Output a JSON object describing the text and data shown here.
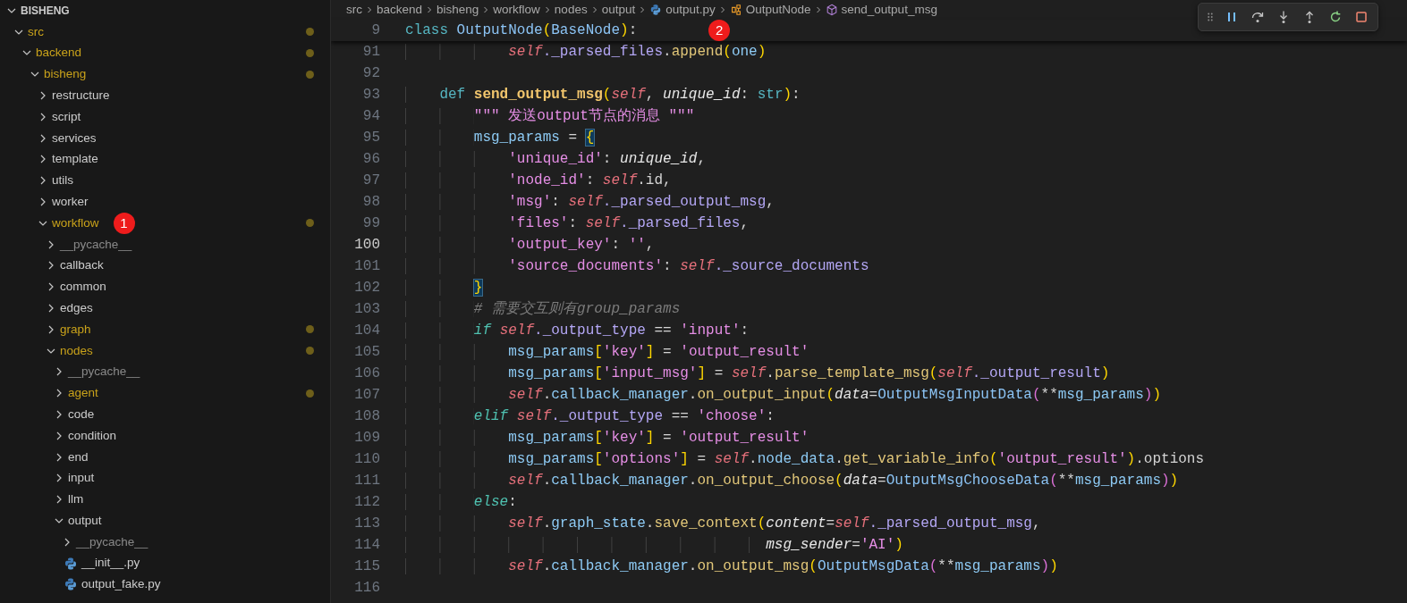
{
  "explorer": {
    "title": "BISHENG",
    "expanded": true,
    "items": [
      {
        "label": "src",
        "kind": "folder",
        "expanded": true,
        "modified": true,
        "ignored": false,
        "children": [
          {
            "label": "backend",
            "kind": "folder",
            "expanded": true,
            "modified": true,
            "ignored": false,
            "children": [
              {
                "label": "bisheng",
                "kind": "folder",
                "expanded": true,
                "modified": true,
                "ignored": false,
                "children": [
                  {
                    "label": "restructure",
                    "kind": "folder",
                    "expanded": false,
                    "modified": false,
                    "ignored": false
                  },
                  {
                    "label": "script",
                    "kind": "folder",
                    "expanded": false,
                    "modified": false,
                    "ignored": false
                  },
                  {
                    "label": "services",
                    "kind": "folder",
                    "expanded": false,
                    "modified": false,
                    "ignored": false
                  },
                  {
                    "label": "template",
                    "kind": "folder",
                    "expanded": false,
                    "modified": false,
                    "ignored": false
                  },
                  {
                    "label": "utils",
                    "kind": "folder",
                    "expanded": false,
                    "modified": false,
                    "ignored": false
                  },
                  {
                    "label": "worker",
                    "kind": "folder",
                    "expanded": false,
                    "modified": false,
                    "ignored": false
                  },
                  {
                    "label": "workflow",
                    "kind": "folder",
                    "expanded": true,
                    "modified": true,
                    "ignored": false,
                    "badge": "1",
                    "children": [
                      {
                        "label": "__pycache__",
                        "kind": "folder",
                        "expanded": false,
                        "modified": false,
                        "ignored": true
                      },
                      {
                        "label": "callback",
                        "kind": "folder",
                        "expanded": false,
                        "modified": false,
                        "ignored": false
                      },
                      {
                        "label": "common",
                        "kind": "folder",
                        "expanded": false,
                        "modified": false,
                        "ignored": false
                      },
                      {
                        "label": "edges",
                        "kind": "folder",
                        "expanded": false,
                        "modified": false,
                        "ignored": false
                      },
                      {
                        "label": "graph",
                        "kind": "folder",
                        "expanded": false,
                        "modified": true,
                        "ignored": false
                      },
                      {
                        "label": "nodes",
                        "kind": "folder",
                        "expanded": true,
                        "modified": true,
                        "ignored": false,
                        "children": [
                          {
                            "label": "__pycache__",
                            "kind": "folder",
                            "expanded": false,
                            "modified": false,
                            "ignored": true
                          },
                          {
                            "label": "agent",
                            "kind": "folder",
                            "expanded": false,
                            "modified": true,
                            "ignored": false
                          },
                          {
                            "label": "code",
                            "kind": "folder",
                            "expanded": false,
                            "modified": false,
                            "ignored": false
                          },
                          {
                            "label": "condition",
                            "kind": "folder",
                            "expanded": false,
                            "modified": false,
                            "ignored": false
                          },
                          {
                            "label": "end",
                            "kind": "folder",
                            "expanded": false,
                            "modified": false,
                            "ignored": false
                          },
                          {
                            "label": "input",
                            "kind": "folder",
                            "expanded": false,
                            "modified": false,
                            "ignored": false
                          },
                          {
                            "label": "llm",
                            "kind": "folder",
                            "expanded": false,
                            "modified": false,
                            "ignored": false
                          },
                          {
                            "label": "output",
                            "kind": "folder",
                            "expanded": true,
                            "modified": false,
                            "ignored": false,
                            "children": [
                              {
                                "label": "__pycache__",
                                "kind": "folder",
                                "expanded": false,
                                "modified": false,
                                "ignored": true
                              },
                              {
                                "label": "__init__.py",
                                "kind": "file",
                                "modified": false,
                                "ignored": false
                              },
                              {
                                "label": "output_fake.py",
                                "kind": "file",
                                "modified": false,
                                "ignored": false
                              }
                            ]
                          }
                        ]
                      }
                    ]
                  }
                ]
              }
            ]
          }
        ]
      }
    ]
  },
  "breadcrumbs": [
    {
      "label": "src",
      "kind": "folder"
    },
    {
      "label": "backend",
      "kind": "folder"
    },
    {
      "label": "bisheng",
      "kind": "folder"
    },
    {
      "label": "workflow",
      "kind": "folder"
    },
    {
      "label": "nodes",
      "kind": "folder"
    },
    {
      "label": "output",
      "kind": "folder"
    },
    {
      "label": "output.py",
      "kind": "file"
    },
    {
      "label": "OutputNode",
      "kind": "class"
    },
    {
      "label": "send_output_msg",
      "kind": "method"
    }
  ],
  "debug_toolbar": {
    "buttons": [
      {
        "kind": "grip"
      },
      {
        "kind": "pause"
      },
      {
        "kind": "stepover"
      },
      {
        "kind": "stepinto"
      },
      {
        "kind": "stepout"
      },
      {
        "kind": "restart"
      },
      {
        "kind": "stop"
      }
    ]
  },
  "editor": {
    "sticky_line": {
      "number": "9",
      "badge": "2",
      "tokens": [
        {
          "text": "class ",
          "kind": "keyword"
        },
        {
          "text": "OutputNode",
          "kind": "class"
        },
        {
          "text": "(",
          "kind": "bracket"
        },
        {
          "text": "BaseNode",
          "kind": "class"
        },
        {
          "text": ")",
          "kind": "bracket"
        },
        {
          "text": ":",
          "kind": "punct"
        }
      ]
    },
    "lines": [
      {
        "number": "91",
        "current": false,
        "tokens": [
          {
            "text": "            self",
            "kind": "self"
          },
          {
            "text": "._parsed_files",
            "kind": "attribute"
          },
          {
            "text": ".",
            "kind": "punct"
          },
          {
            "text": "append",
            "kind": "method"
          },
          {
            "text": "(",
            "kind": "bracket"
          },
          {
            "text": "one",
            "kind": "variable"
          },
          {
            "text": ")",
            "kind": "bracket"
          }
        ]
      },
      {
        "number": "92",
        "current": false
      },
      {
        "number": "93",
        "current": false,
        "tokens": [
          {
            "text": "    def ",
            "kind": "keyword"
          },
          {
            "text": "send_output_msg",
            "kind": "function"
          },
          {
            "text": "(",
            "kind": "bracket"
          },
          {
            "text": "self",
            "kind": "self"
          },
          {
            "text": ", ",
            "kind": "punct"
          },
          {
            "text": "unique_id",
            "kind": "param"
          },
          {
            "text": ": ",
            "kind": "punct"
          },
          {
            "text": "str",
            "kind": "builtin"
          },
          {
            "text": ")",
            "kind": "bracket"
          },
          {
            "text": ":",
            "kind": "punct"
          }
        ]
      },
      {
        "number": "94",
        "current": false,
        "tokens": [
          {
            "text": "        \"\"\" 发送output节点的消息 \"\"\"",
            "kind": "string"
          }
        ]
      },
      {
        "number": "95",
        "current": false,
        "tokens": [
          {
            "text": "        msg_params",
            "kind": "variable"
          },
          {
            "text": " = ",
            "kind": "punct"
          },
          {
            "text": "{",
            "kind": "match"
          }
        ]
      },
      {
        "number": "96",
        "current": false,
        "tokens": [
          {
            "text": "            'unique_id'",
            "kind": "string"
          },
          {
            "text": ": ",
            "kind": "punct"
          },
          {
            "text": "unique_id",
            "kind": "param"
          },
          {
            "text": ",",
            "kind": "punct"
          }
        ]
      },
      {
        "number": "97",
        "current": false,
        "tokens": [
          {
            "text": "            'node_id'",
            "kind": "string"
          },
          {
            "text": ": ",
            "kind": "punct"
          },
          {
            "text": "self",
            "kind": "self"
          },
          {
            "text": ".id",
            "kind": "property"
          },
          {
            "text": ",",
            "kind": "punct"
          }
        ]
      },
      {
        "number": "98",
        "current": false,
        "tokens": [
          {
            "text": "            'msg'",
            "kind": "string"
          },
          {
            "text": ": ",
            "kind": "punct"
          },
          {
            "text": "self",
            "kind": "self"
          },
          {
            "text": "._parsed_output_msg",
            "kind": "attribute"
          },
          {
            "text": ",",
            "kind": "punct"
          }
        ]
      },
      {
        "number": "99",
        "current": false,
        "tokens": [
          {
            "text": "            'files'",
            "kind": "string"
          },
          {
            "text": ": ",
            "kind": "punct"
          },
          {
            "text": "self",
            "kind": "self"
          },
          {
            "text": "._parsed_files",
            "kind": "attribute"
          },
          {
            "text": ",",
            "kind": "punct"
          }
        ]
      },
      {
        "number": "100",
        "current": true,
        "tokens": [
          {
            "text": "            'output_key'",
            "kind": "string"
          },
          {
            "text": ": ",
            "kind": "punct"
          },
          {
            "text": "''",
            "kind": "string"
          },
          {
            "text": ",",
            "kind": "punct"
          }
        ]
      },
      {
        "number": "101",
        "current": false,
        "tokens": [
          {
            "text": "            'source_documents'",
            "kind": "string"
          },
          {
            "text": ": ",
            "kind": "punct"
          },
          {
            "text": "self",
            "kind": "self"
          },
          {
            "text": "._source_documents",
            "kind": "attribute"
          }
        ]
      },
      {
        "number": "102",
        "current": false,
        "tokens": [
          {
            "text": "        }",
            "kind": "match"
          }
        ]
      },
      {
        "number": "103",
        "current": false,
        "tokens": [
          {
            "text": "        # 需要交互则有group_params",
            "kind": "comment"
          }
        ]
      },
      {
        "number": "104",
        "current": false,
        "tokens": [
          {
            "text": "        if ",
            "kind": "control"
          },
          {
            "text": "self",
            "kind": "self"
          },
          {
            "text": "._output_type",
            "kind": "attribute"
          },
          {
            "text": " == ",
            "kind": "punct"
          },
          {
            "text": "'input'",
            "kind": "string"
          },
          {
            "text": ":",
            "kind": "punct"
          }
        ]
      },
      {
        "number": "105",
        "current": false,
        "tokens": [
          {
            "text": "            msg_params",
            "kind": "variable"
          },
          {
            "text": "[",
            "kind": "bracket"
          },
          {
            "text": "'key'",
            "kind": "string"
          },
          {
            "text": "]",
            "kind": "bracket"
          },
          {
            "text": " = ",
            "kind": "punct"
          },
          {
            "text": "'output_result'",
            "kind": "string"
          }
        ]
      },
      {
        "number": "106",
        "current": false,
        "tokens": [
          {
            "text": "            msg_params",
            "kind": "variable"
          },
          {
            "text": "[",
            "kind": "bracket"
          },
          {
            "text": "'input_msg'",
            "kind": "string"
          },
          {
            "text": "]",
            "kind": "bracket"
          },
          {
            "text": " = ",
            "kind": "punct"
          },
          {
            "text": "self",
            "kind": "self"
          },
          {
            "text": ".",
            "kind": "punct"
          },
          {
            "text": "parse_template_msg",
            "kind": "method"
          },
          {
            "text": "(",
            "kind": "bracket"
          },
          {
            "text": "self",
            "kind": "self"
          },
          {
            "text": "._output_result",
            "kind": "attribute"
          },
          {
            "text": ")",
            "kind": "bracket"
          }
        ]
      },
      {
        "number": "107",
        "current": false,
        "tokens": [
          {
            "text": "            self",
            "kind": "self"
          },
          {
            "text": ".",
            "kind": "punct"
          },
          {
            "text": "callback_manager",
            "kind": "member"
          },
          {
            "text": ".",
            "kind": "punct"
          },
          {
            "text": "on_output_input",
            "kind": "method"
          },
          {
            "text": "(",
            "kind": "bracket"
          },
          {
            "text": "data",
            "kind": "param"
          },
          {
            "text": "=",
            "kind": "punct"
          },
          {
            "text": "OutputMsgInputData",
            "kind": "class"
          },
          {
            "text": "(",
            "kind": "bracket2"
          },
          {
            "text": "**",
            "kind": "punct"
          },
          {
            "text": "msg_params",
            "kind": "variable"
          },
          {
            "text": ")",
            "kind": "bracket2"
          },
          {
            "text": ")",
            "kind": "bracket"
          }
        ]
      },
      {
        "number": "108",
        "current": false,
        "tokens": [
          {
            "text": "        elif ",
            "kind": "control"
          },
          {
            "text": "self",
            "kind": "self"
          },
          {
            "text": "._output_type",
            "kind": "attribute"
          },
          {
            "text": " == ",
            "kind": "punct"
          },
          {
            "text": "'choose'",
            "kind": "string"
          },
          {
            "text": ":",
            "kind": "punct"
          }
        ]
      },
      {
        "number": "109",
        "current": false,
        "tokens": [
          {
            "text": "            msg_params",
            "kind": "variable"
          },
          {
            "text": "[",
            "kind": "bracket"
          },
          {
            "text": "'key'",
            "kind": "string"
          },
          {
            "text": "]",
            "kind": "bracket"
          },
          {
            "text": " = ",
            "kind": "punct"
          },
          {
            "text": "'output_result'",
            "kind": "string"
          }
        ]
      },
      {
        "number": "110",
        "current": false,
        "tokens": [
          {
            "text": "            msg_params",
            "kind": "variable"
          },
          {
            "text": "[",
            "kind": "bracket"
          },
          {
            "text": "'options'",
            "kind": "string"
          },
          {
            "text": "]",
            "kind": "bracket"
          },
          {
            "text": " = ",
            "kind": "punct"
          },
          {
            "text": "self",
            "kind": "self"
          },
          {
            "text": ".",
            "kind": "punct"
          },
          {
            "text": "node_data",
            "kind": "member"
          },
          {
            "text": ".",
            "kind": "punct"
          },
          {
            "text": "get_variable_info",
            "kind": "method"
          },
          {
            "text": "(",
            "kind": "bracket"
          },
          {
            "text": "'output_result'",
            "kind": "string"
          },
          {
            "text": ")",
            "kind": "bracket"
          },
          {
            "text": ".options",
            "kind": "property"
          }
        ]
      },
      {
        "number": "111",
        "current": false,
        "tokens": [
          {
            "text": "            self",
            "kind": "self"
          },
          {
            "text": ".",
            "kind": "punct"
          },
          {
            "text": "callback_manager",
            "kind": "member"
          },
          {
            "text": ".",
            "kind": "punct"
          },
          {
            "text": "on_output_choose",
            "kind": "method"
          },
          {
            "text": "(",
            "kind": "bracket"
          },
          {
            "text": "data",
            "kind": "param"
          },
          {
            "text": "=",
            "kind": "punct"
          },
          {
            "text": "OutputMsgChooseData",
            "kind": "class"
          },
          {
            "text": "(",
            "kind": "bracket2"
          },
          {
            "text": "**",
            "kind": "punct"
          },
          {
            "text": "msg_params",
            "kind": "variable"
          },
          {
            "text": ")",
            "kind": "bracket2"
          },
          {
            "text": ")",
            "kind": "bracket"
          }
        ]
      },
      {
        "number": "112",
        "current": false,
        "tokens": [
          {
            "text": "        else",
            "kind": "control"
          },
          {
            "text": ":",
            "kind": "punct"
          }
        ]
      },
      {
        "number": "113",
        "current": false,
        "tokens": [
          {
            "text": "            self",
            "kind": "self"
          },
          {
            "text": ".",
            "kind": "punct"
          },
          {
            "text": "graph_state",
            "kind": "member"
          },
          {
            "text": ".",
            "kind": "punct"
          },
          {
            "text": "save_context",
            "kind": "method"
          },
          {
            "text": "(",
            "kind": "bracket"
          },
          {
            "text": "content",
            "kind": "param"
          },
          {
            "text": "=",
            "kind": "punct"
          },
          {
            "text": "self",
            "kind": "self"
          },
          {
            "text": "._parsed_output_msg",
            "kind": "attribute"
          },
          {
            "text": ",",
            "kind": "punct"
          }
        ]
      },
      {
        "number": "114",
        "current": false,
        "tokens": [
          {
            "text": "                                          msg_sender",
            "kind": "param"
          },
          {
            "text": "=",
            "kind": "punct"
          },
          {
            "text": "'AI'",
            "kind": "string"
          },
          {
            "text": ")",
            "kind": "bracket"
          }
        ]
      },
      {
        "number": "115",
        "current": false,
        "tokens": [
          {
            "text": "            self",
            "kind": "self"
          },
          {
            "text": ".",
            "kind": "punct"
          },
          {
            "text": "callback_manager",
            "kind": "member"
          },
          {
            "text": ".",
            "kind": "punct"
          },
          {
            "text": "on_output_msg",
            "kind": "method"
          },
          {
            "text": "(",
            "kind": "bracket"
          },
          {
            "text": "OutputMsgData",
            "kind": "class"
          },
          {
            "text": "(",
            "kind": "bracket2"
          },
          {
            "text": "**",
            "kind": "punct"
          },
          {
            "text": "msg_params",
            "kind": "variable"
          },
          {
            "text": ")",
            "kind": "bracket2"
          },
          {
            "text": ")",
            "kind": "bracket"
          }
        ]
      },
      {
        "number": "116",
        "current": false
      }
    ]
  }
}
